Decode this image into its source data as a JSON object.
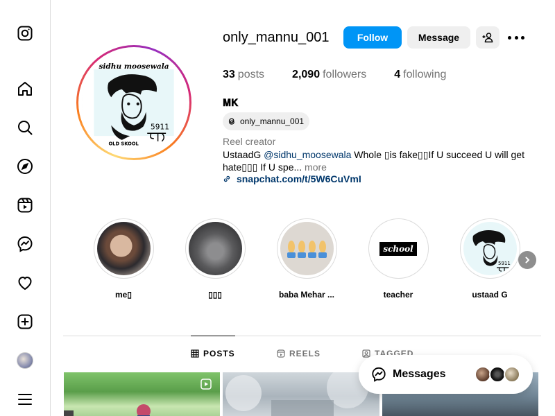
{
  "nav": {
    "items": [
      "instagram",
      "home",
      "search",
      "explore",
      "reels",
      "messages",
      "notifications",
      "create",
      "profile",
      "more"
    ]
  },
  "header": {
    "username": "only_mannu_001",
    "follow_label": "Follow",
    "message_label": "Message",
    "avatar_text_top": "sidhu moosewala",
    "avatar_text_bottom": "OLD SKOOL",
    "avatar_number": "5911"
  },
  "stats": {
    "posts_count": "33",
    "posts_label": "posts",
    "followers_count": "2,090",
    "followers_label": "followers",
    "following_count": "4",
    "following_label": "following"
  },
  "bio": {
    "full_name": "𝐌𝐊",
    "threads_handle": "only_mannu_001",
    "category": "Reel creator",
    "text_prefix": "UstaadG ",
    "mention": "@sidhu_moosewala",
    "text_suffix": " Whole ▯is fake▯▯If U succeed U will get hate▯▯▯ If U spe...",
    "more_label": " more",
    "link": "snapchat.com/t/5W6CuVmI"
  },
  "highlights": [
    {
      "label": "me▯"
    },
    {
      "label": "▯▯▯"
    },
    {
      "label": "baba Mehar ..."
    },
    {
      "label": "teacher",
      "image_text": "school"
    },
    {
      "label": "ustaad G",
      "image_number": "5911"
    }
  ],
  "tabs": [
    {
      "label": "POSTS",
      "active": true
    },
    {
      "label": "REELS",
      "active": false
    },
    {
      "label": "TAGGED",
      "active": false
    }
  ],
  "messages": {
    "label": "Messages"
  },
  "colors": {
    "accent": "#0095f6",
    "link": "#00376b",
    "muted": "#737373"
  }
}
